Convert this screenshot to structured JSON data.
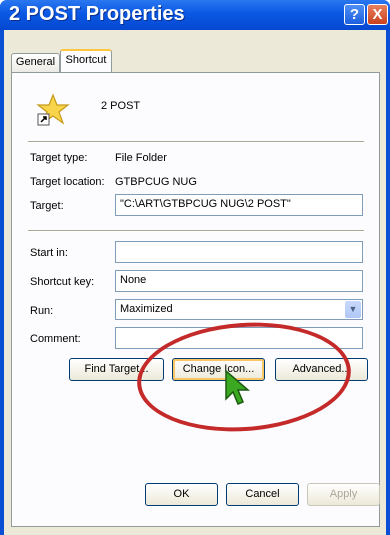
{
  "window": {
    "title": "2 POST Properties",
    "help_label": "?",
    "close_label": "X"
  },
  "tabs": [
    {
      "label": "General",
      "active": false
    },
    {
      "label": "Shortcut",
      "active": true
    }
  ],
  "shortcut": {
    "name": "2 POST",
    "icon": "star-shortcut-icon",
    "target_type_label": "Target type:",
    "target_type_value": "File Folder",
    "target_location_label": "Target location:",
    "target_location_value": "GTBPCUG NUG",
    "target_label": "Target:",
    "target_value": "\"C:\\ART\\GTBPCUG NUG\\2 POST\"",
    "start_in_label": "Start in:",
    "start_in_value": "",
    "shortcut_key_label": "Shortcut key:",
    "shortcut_key_value": "None",
    "run_label": "Run:",
    "run_value": "Maximized",
    "comment_label": "Comment:",
    "comment_value": "",
    "find_target_label": "Find Target...",
    "change_icon_label": "Change Icon...",
    "advanced_label": "Advanced..."
  },
  "footer": {
    "ok_label": "OK",
    "cancel_label": "Cancel",
    "apply_label": "Apply"
  },
  "colors": {
    "annotation_ellipse": "#c42a2a",
    "cursor": "#3aa820",
    "titlebar": "#0a58e4"
  }
}
